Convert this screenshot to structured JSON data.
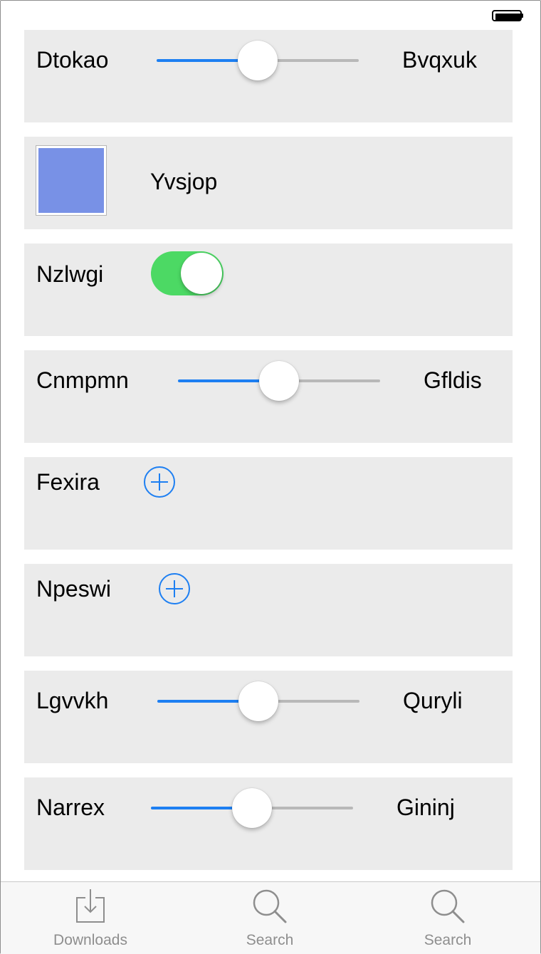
{
  "colors": {
    "accent": "#1d7ff2",
    "toggle_on": "#4cd964",
    "card_bg": "#ebebeb",
    "swatch": "#7891e6",
    "tab_inactive": "#8e8e8e"
  },
  "rows": [
    {
      "type": "slider",
      "label": "Dtokao",
      "max_label": "Bvqxuk",
      "value": 0.5
    },
    {
      "type": "color",
      "label": "Yvsjop",
      "color": "#7891e6"
    },
    {
      "type": "toggle",
      "label": "Nzlwgi",
      "on": true
    },
    {
      "type": "slider",
      "label": "Cnmpmn",
      "max_label": "Gfldis",
      "value": 0.5
    },
    {
      "type": "add",
      "label": "Fexira",
      "icon": "plus-circle-icon"
    },
    {
      "type": "add",
      "label": "Npeswi",
      "icon": "plus-circle-icon"
    },
    {
      "type": "slider",
      "label": "Lgvvkh",
      "max_label": "Quryli",
      "value": 0.5
    },
    {
      "type": "slider",
      "label": "Narrex",
      "max_label": "Gininj",
      "value": 0.5
    }
  ],
  "tabbar": {
    "tabs": [
      {
        "label": "Downloads",
        "icon": "download-icon"
      },
      {
        "label": "Search",
        "icon": "search-icon"
      },
      {
        "label": "Search",
        "icon": "search-icon"
      }
    ]
  },
  "status_bar": {
    "icon": "battery-icon"
  }
}
